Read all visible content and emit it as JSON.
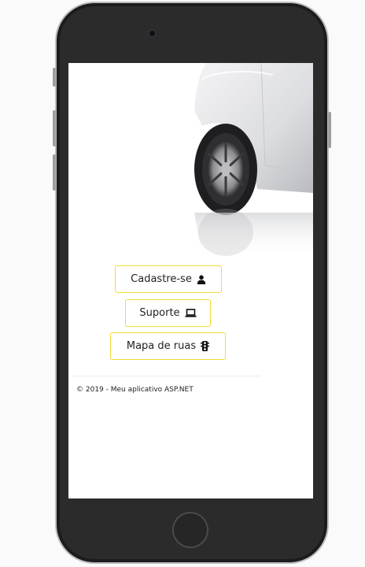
{
  "buttons": {
    "register_label": "Cadastre-se",
    "support_label": "Suporte",
    "map_label": "Mapa de ruas"
  },
  "icons": {
    "register": "user-icon",
    "support": "laptop-icon",
    "map": "traffic-light-icon"
  },
  "footer": {
    "copyright": "© 2019 - Meu aplicativo ASP.NET"
  },
  "colors": {
    "button_border": "#f2dc35",
    "phone_body": "#2b2b2b",
    "screen_bg": "#ffffff"
  }
}
